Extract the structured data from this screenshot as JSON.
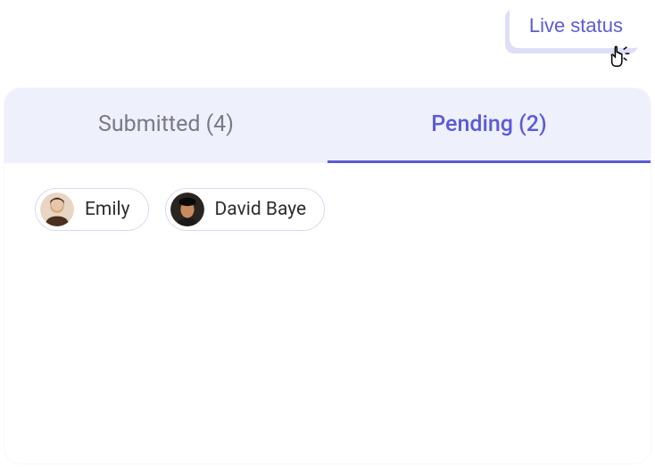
{
  "live_status": {
    "label": "Live status"
  },
  "tabs": {
    "submitted": {
      "label": "Submitted (4)",
      "active": false
    },
    "pending": {
      "label": "Pending (2)",
      "active": true
    }
  },
  "people": [
    {
      "name": "Emily",
      "avatar_bg": "#e8d5c4",
      "avatar_fg": "#6b4423"
    },
    {
      "name": "David Baye",
      "avatar_bg": "#1a1a1a",
      "avatar_fg": "#c98b5e"
    }
  ],
  "colors": {
    "accent": "#5b5bd6"
  }
}
